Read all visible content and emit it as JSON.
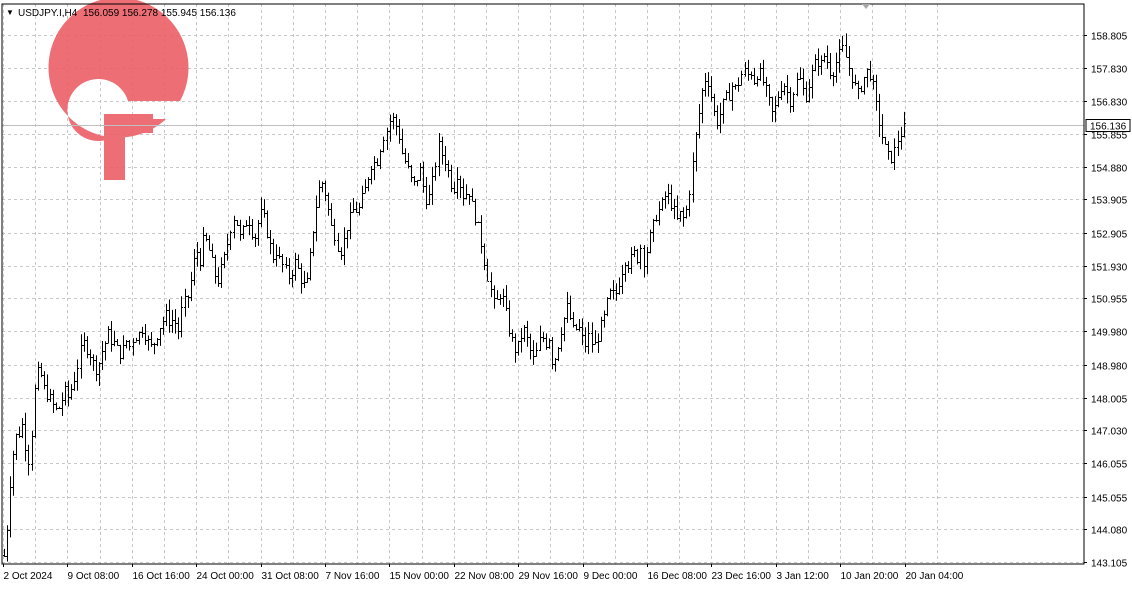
{
  "header": {
    "arrow_glyph": "▼",
    "symbol": "USDJPY.I,H4",
    "ohlc": "156.059 156.278 155.945 156.136"
  },
  "logo": {
    "name": "logo-mark",
    "color": "#ec5f67"
  },
  "colors": {
    "background": "#ffffff",
    "grid": "#c8c8c8",
    "bars": "#000000",
    "axis_text": "#000000",
    "price_line": "#c0c0c0",
    "price_label_bg": "#ffffff",
    "logo": "#ec5f67"
  },
  "chart_data": {
    "type": "ohlc",
    "title": "USDJPY.I,H4",
    "ylim": [
      143.105,
      158.805
    ],
    "grid": true,
    "current_price": "156.136",
    "y_ticks": [
      "158.805",
      "157.830",
      "156.830",
      "155.855",
      "154.880",
      "153.905",
      "152.905",
      "151.930",
      "150.955",
      "149.980",
      "148.980",
      "148.005",
      "147.030",
      "146.055",
      "145.055",
      "144.080",
      "143.105"
    ],
    "x_ticks": [
      "2 Oct 2024",
      "9 Oct 08:00",
      "16 Oct 16:00",
      "24 Oct 00:00",
      "31 Oct 08:00",
      "7 Nov 16:00",
      "15 Nov 00:00",
      "22 Nov 08:00",
      "29 Nov 16:00",
      "9 Dec 00:00",
      "16 Dec 08:00",
      "23 Dec 16:00",
      "3 Jan 12:00",
      "10 Jan 20:00",
      "20 Jan 04:00"
    ],
    "path": [
      [
        0,
        143.3
      ],
      [
        3,
        144.3
      ],
      [
        6,
        146.1
      ],
      [
        9,
        146.6
      ],
      [
        11,
        147.1
      ],
      [
        13,
        146.9
      ],
      [
        15,
        147.2
      ],
      [
        17,
        146.7
      ],
      [
        19,
        146.3
      ],
      [
        21,
        146.0
      ],
      [
        23,
        147.3
      ],
      [
        26,
        148.7
      ],
      [
        29,
        148.8
      ],
      [
        33,
        148.2
      ],
      [
        37,
        148.0
      ],
      [
        41,
        147.7
      ],
      [
        44,
        147.6
      ],
      [
        47,
        147.9
      ],
      [
        50,
        148.2
      ],
      [
        53,
        148.0
      ],
      [
        56,
        148.4
      ],
      [
        59,
        148.8
      ],
      [
        61,
        149.1
      ],
      [
        64,
        149.7
      ],
      [
        67,
        149.5
      ],
      [
        70,
        149.3
      ],
      [
        73,
        149.0
      ],
      [
        76,
        148.8
      ],
      [
        79,
        149.3
      ],
      [
        82,
        149.6
      ],
      [
        85,
        149.9
      ],
      [
        88,
        149.7
      ],
      [
        91,
        149.6
      ],
      [
        94,
        149.3
      ],
      [
        97,
        149.4
      ],
      [
        100,
        149.7
      ],
      [
        103,
        149.5
      ],
      [
        106,
        149.9
      ],
      [
        109,
        149.8
      ],
      [
        112,
        150.1
      ],
      [
        115,
        149.9
      ],
      [
        118,
        149.6
      ],
      [
        121,
        149.5
      ],
      [
        124,
        149.8
      ],
      [
        127,
        150.1
      ],
      [
        130,
        150.3
      ],
      [
        133,
        150.5
      ],
      [
        136,
        150.2
      ],
      [
        139,
        150.4
      ],
      [
        142,
        149.9
      ],
      [
        145,
        150.6
      ],
      [
        148,
        150.9
      ],
      [
        151,
        151.1
      ],
      [
        154,
        151.9
      ],
      [
        157,
        152.4
      ],
      [
        160,
        152.1
      ],
      [
        163,
        152.8
      ],
      [
        166,
        152.6
      ],
      [
        169,
        152.2
      ],
      [
        172,
        151.7
      ],
      [
        175,
        151.5
      ],
      [
        178,
        151.9
      ],
      [
        181,
        152.3
      ],
      [
        184,
        152.9
      ],
      [
        187,
        153.4
      ],
      [
        190,
        153.2
      ],
      [
        193,
        152.7
      ],
      [
        196,
        153.1
      ],
      [
        199,
        153.4
      ],
      [
        202,
        153.0
      ],
      [
        205,
        152.8
      ],
      [
        208,
        153.3
      ],
      [
        211,
        153.6
      ],
      [
        214,
        153.1
      ],
      [
        217,
        152.6
      ],
      [
        220,
        152.2
      ],
      [
        223,
        152.4
      ],
      [
        226,
        152.0
      ],
      [
        229,
        151.9
      ],
      [
        232,
        151.6
      ],
      [
        235,
        151.8
      ],
      [
        238,
        152.1
      ],
      [
        241,
        151.7
      ],
      [
        244,
        151.4
      ],
      [
        247,
        151.3
      ],
      [
        250,
        152.2
      ],
      [
        253,
        153.2
      ],
      [
        256,
        154.0
      ],
      [
        259,
        154.5
      ],
      [
        262,
        154.2
      ],
      [
        265,
        153.6
      ],
      [
        268,
        153.0
      ],
      [
        271,
        152.8
      ],
      [
        274,
        152.3
      ],
      [
        277,
        152.6
      ],
      [
        280,
        153.1
      ],
      [
        283,
        153.4
      ],
      [
        286,
        153.7
      ],
      [
        289,
        153.5
      ],
      [
        292,
        153.9
      ],
      [
        295,
        154.2
      ],
      [
        298,
        154.7
      ],
      [
        301,
        155.1
      ],
      [
        304,
        154.9
      ],
      [
        307,
        155.4
      ],
      [
        310,
        155.8
      ],
      [
        313,
        156.0
      ],
      [
        316,
        156.4
      ],
      [
        319,
        156.2
      ],
      [
        322,
        155.9
      ],
      [
        325,
        155.3
      ],
      [
        328,
        155.0
      ],
      [
        331,
        154.7
      ],
      [
        334,
        154.3
      ],
      [
        337,
        154.5
      ],
      [
        340,
        154.8
      ],
      [
        343,
        154.2
      ],
      [
        346,
        153.8
      ],
      [
        349,
        154.2
      ],
      [
        352,
        154.9
      ],
      [
        355,
        155.5
      ],
      [
        358,
        155.2
      ],
      [
        361,
        155.0
      ],
      [
        364,
        154.5
      ],
      [
        367,
        154.2
      ],
      [
        370,
        154.7
      ],
      [
        373,
        154.3
      ],
      [
        376,
        153.9
      ],
      [
        379,
        154.3
      ],
      [
        382,
        153.8
      ],
      [
        385,
        153.4
      ],
      [
        388,
        153.0
      ],
      [
        391,
        152.4
      ],
      [
        394,
        151.8
      ],
      [
        397,
        151.3
      ],
      [
        400,
        150.8
      ],
      [
        403,
        150.9
      ],
      [
        406,
        151.2
      ],
      [
        409,
        150.7
      ],
      [
        412,
        150.1
      ],
      [
        415,
        149.7
      ],
      [
        418,
        149.4
      ],
      [
        421,
        149.6
      ],
      [
        424,
        150.1
      ],
      [
        427,
        149.8
      ],
      [
        430,
        149.4
      ],
      [
        433,
        149.1
      ],
      [
        436,
        149.5
      ],
      [
        439,
        149.9
      ],
      [
        442,
        149.6
      ],
      [
        445,
        149.8
      ],
      [
        448,
        149.0
      ],
      [
        451,
        149.3
      ],
      [
        454,
        149.9
      ],
      [
        457,
        150.3
      ],
      [
        460,
        150.7
      ],
      [
        463,
        150.3
      ],
      [
        466,
        149.9
      ],
      [
        469,
        150.2
      ],
      [
        472,
        149.8
      ],
      [
        475,
        149.6
      ],
      [
        478,
        149.9
      ],
      [
        481,
        149.5
      ],
      [
        484,
        149.7
      ],
      [
        487,
        150.1
      ],
      [
        490,
        150.4
      ],
      [
        493,
        150.9
      ],
      [
        496,
        151.2
      ],
      [
        499,
        151.0
      ],
      [
        502,
        151.4
      ],
      [
        505,
        151.8
      ],
      [
        508,
        152.2
      ],
      [
        511,
        151.9
      ],
      [
        514,
        152.4
      ],
      [
        517,
        152.1
      ],
      [
        520,
        152.5
      ],
      [
        523,
        152.0
      ],
      [
        526,
        152.6
      ],
      [
        529,
        153.0
      ],
      [
        532,
        153.4
      ],
      [
        535,
        153.6
      ],
      [
        538,
        153.8
      ],
      [
        541,
        154.1
      ],
      [
        544,
        153.9
      ],
      [
        547,
        153.6
      ],
      [
        550,
        153.3
      ],
      [
        553,
        153.5
      ],
      [
        556,
        153.3
      ],
      [
        559,
        153.9
      ],
      [
        562,
        154.8
      ],
      [
        565,
        155.8
      ],
      [
        568,
        156.6
      ],
      [
        571,
        157.4
      ],
      [
        574,
        157.6
      ],
      [
        577,
        157.1
      ],
      [
        580,
        156.5
      ],
      [
        583,
        156.2
      ],
      [
        586,
        156.6
      ],
      [
        589,
        156.9
      ],
      [
        592,
        157.0
      ],
      [
        595,
        157.3
      ],
      [
        598,
        157.2
      ],
      [
        601,
        157.5
      ],
      [
        604,
        157.8
      ],
      [
        607,
        157.6
      ],
      [
        610,
        157.7
      ],
      [
        613,
        157.4
      ],
      [
        616,
        157.8
      ],
      [
        619,
        157.5
      ],
      [
        622,
        157.2
      ],
      [
        625,
        156.8
      ],
      [
        628,
        156.4
      ],
      [
        631,
        156.8
      ],
      [
        634,
        157.2
      ],
      [
        637,
        157.4
      ],
      [
        640,
        157.1
      ],
      [
        643,
        156.8
      ],
      [
        646,
        157.3
      ],
      [
        649,
        157.6
      ],
      [
        652,
        157.2
      ],
      [
        655,
        157.0
      ],
      [
        658,
        157.4
      ],
      [
        661,
        157.8
      ],
      [
        664,
        158.1
      ],
      [
        667,
        157.9
      ],
      [
        670,
        158.2
      ],
      [
        673,
        158.0
      ],
      [
        676,
        157.6
      ],
      [
        679,
        157.9
      ],
      [
        682,
        158.2
      ],
      [
        685,
        158.4
      ],
      [
        688,
        158.1
      ],
      [
        691,
        157.7
      ],
      [
        694,
        157.4
      ],
      [
        697,
        157.0
      ],
      [
        700,
        157.3
      ],
      [
        703,
        157.6
      ],
      [
        706,
        157.8
      ],
      [
        709,
        157.5
      ],
      [
        712,
        156.8
      ],
      [
        715,
        156.2
      ],
      [
        718,
        155.7
      ],
      [
        721,
        155.3
      ],
      [
        724,
        155.1
      ],
      [
        727,
        155.3
      ],
      [
        730,
        155.7
      ],
      [
        733,
        155.9
      ],
      [
        736,
        156.1
      ]
    ]
  }
}
